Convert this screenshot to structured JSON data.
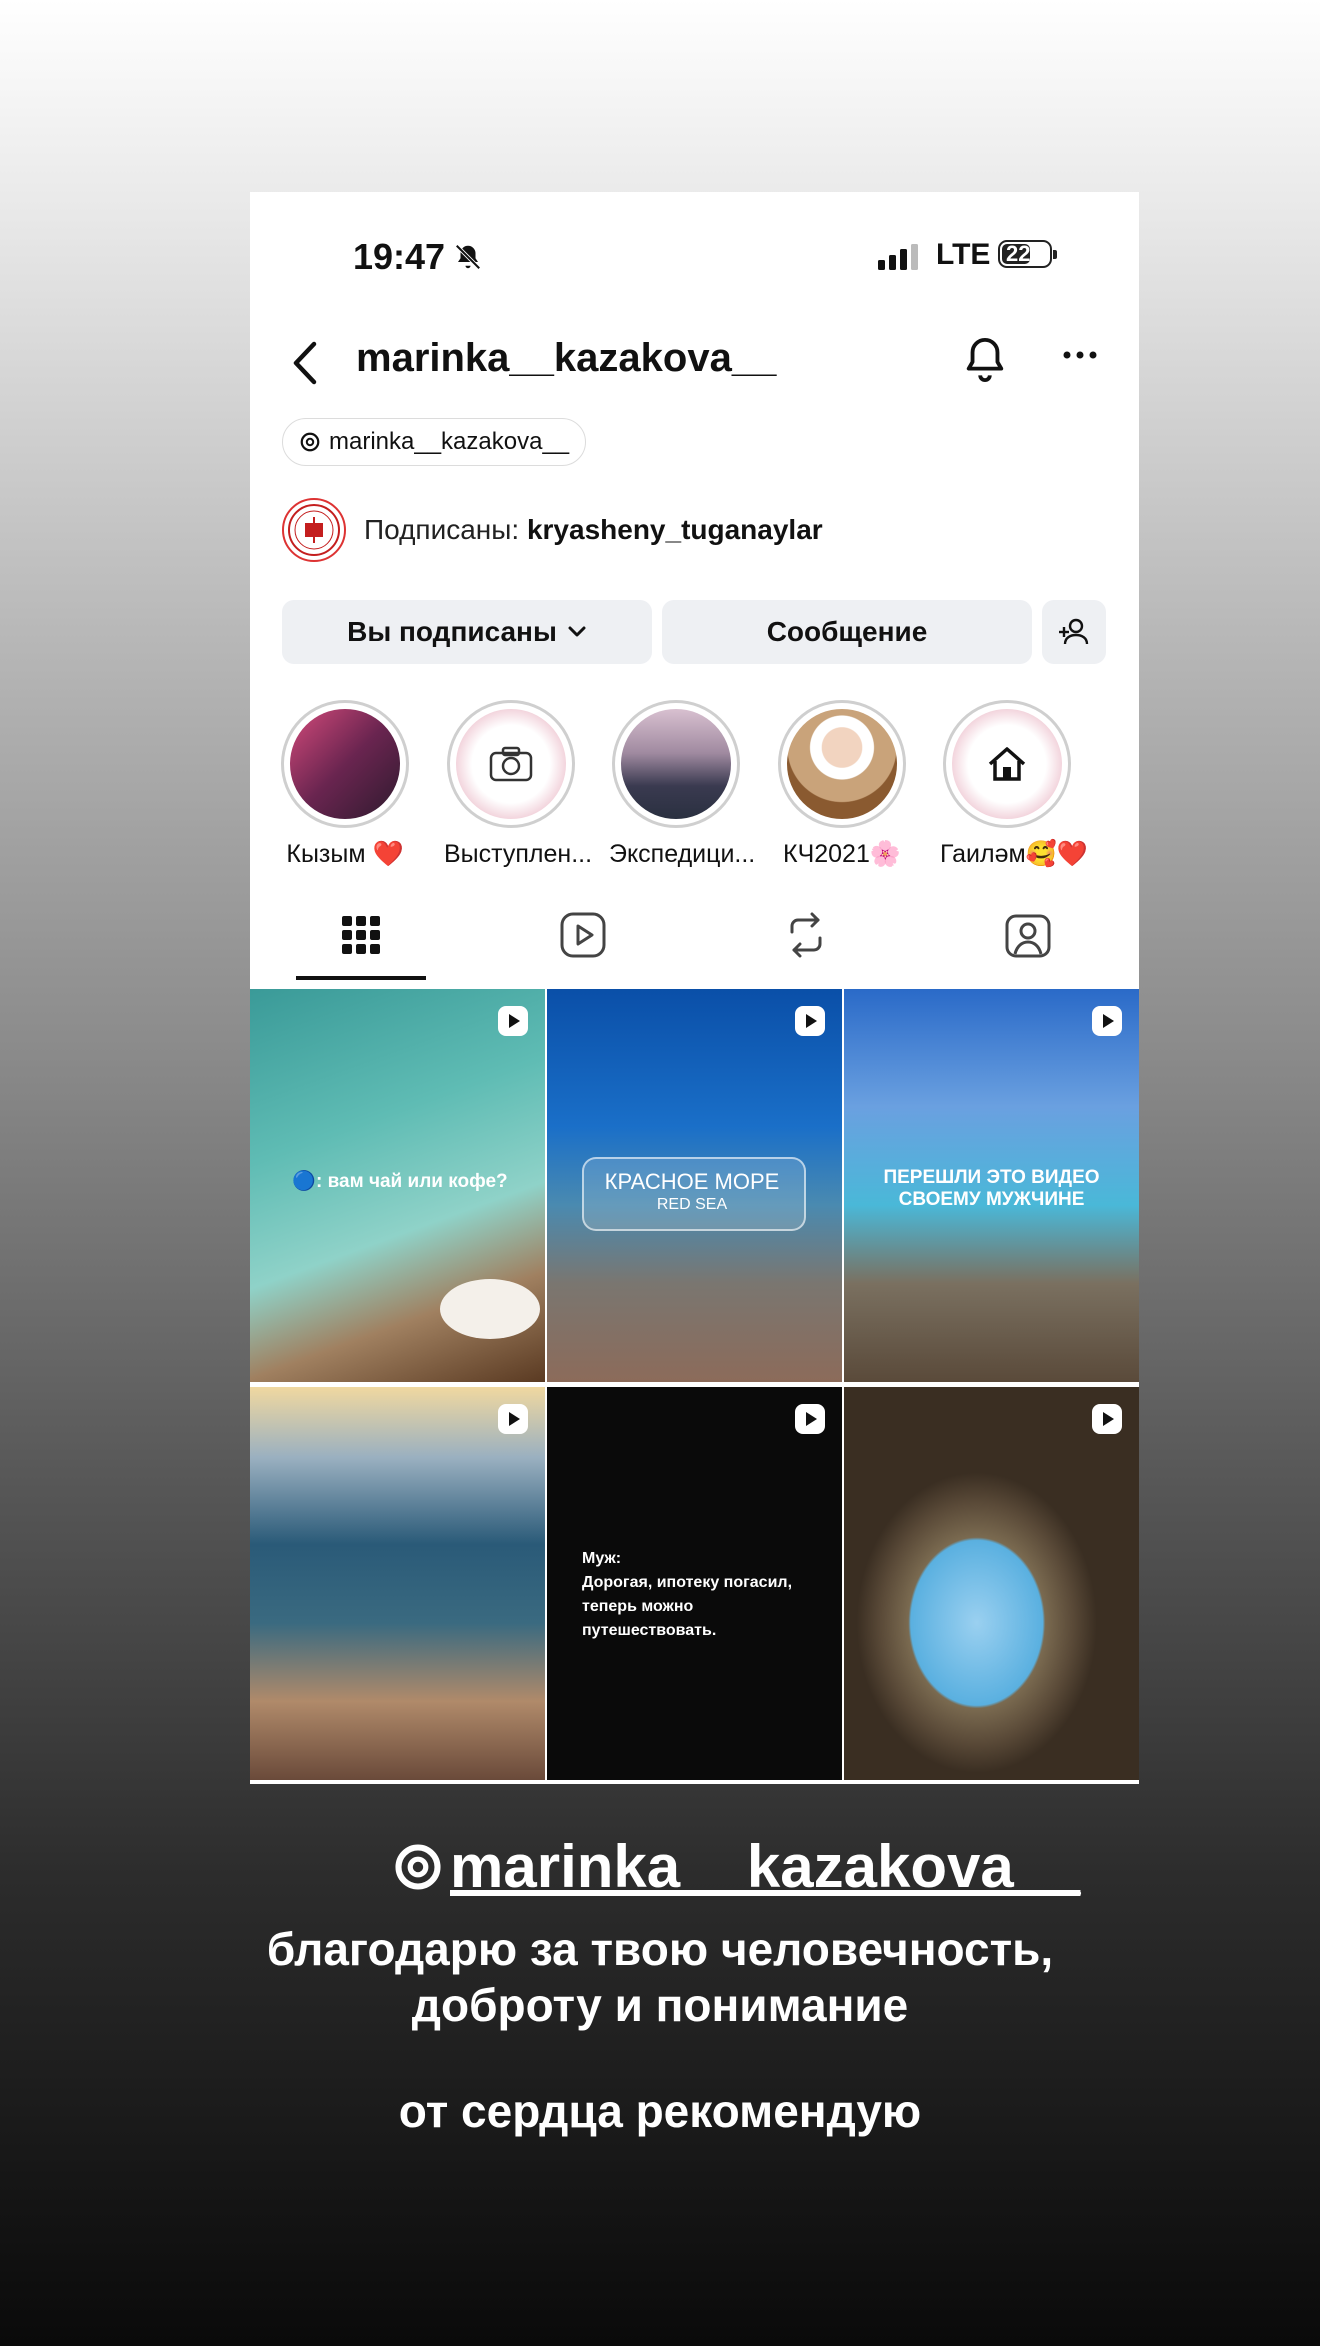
{
  "status_bar": {
    "time": "19:47",
    "network": "LTE",
    "battery": "22"
  },
  "header": {
    "username": "marinka__kazakova__"
  },
  "threads_badge": {
    "handle": "marinka__kazakova__"
  },
  "followed_by": {
    "prefix": "Подписаны:",
    "account": "kryasheny_tuganaylar"
  },
  "actions": {
    "following_label": "Вы подписаны",
    "message_label": "Сообщение"
  },
  "highlights": [
    {
      "label": "Кызым ❤️"
    },
    {
      "label": "Выступлен..."
    },
    {
      "label": "Экспедици..."
    },
    {
      "label": "КЧ2021🌸"
    },
    {
      "label": "Гаиләм🥰❤️"
    }
  ],
  "posts": [
    {
      "text": "🔵: вам чай или кофе?"
    },
    {
      "text": "КРАСНОЕ МОРЕ",
      "subtext": "RED SEA"
    },
    {
      "text": "ПЕРЕШЛИ ЭТО ВИДЕО СВОЕМУ МУЖЧИНЕ"
    },
    {
      "text": ""
    },
    {
      "text": "Муж:\nДорогая, ипотеку погасил, теперь можно путешествовать."
    },
    {
      "text": ""
    }
  ],
  "caption": {
    "handle": "marinka__kazakova__",
    "line1": "благодарю за твою человечность,",
    "line2": "доброту и понимание",
    "line3": "от сердца рекомендую"
  },
  "colors": {
    "button_bg": "#eef0f3",
    "accent_red": "#e0245e"
  },
  "icons": [
    "back-icon",
    "bell-off-icon",
    "signal-icon",
    "notification-bell-icon",
    "more-icon",
    "threads-icon",
    "chevron-down-icon",
    "add-person-icon",
    "grid-icon",
    "reels-icon",
    "reposts-icon",
    "tagged-icon",
    "reel-badge-icon"
  ]
}
